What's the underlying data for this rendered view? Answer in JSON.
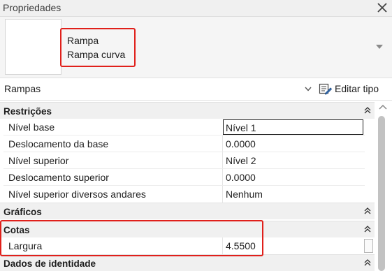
{
  "panel": {
    "title": "Propriedades"
  },
  "type_selector": {
    "family": "Rampa",
    "type": "Rampa curva"
  },
  "filter": {
    "selected": "Rampas",
    "edit_type_label": "Editar tipo"
  },
  "groups": {
    "restricoes": {
      "name": "Restrições",
      "rows": [
        {
          "label": "Nível base",
          "value": "Nível 1"
        },
        {
          "label": "Deslocamento da base",
          "value": "0.0000"
        },
        {
          "label": "Nível superior",
          "value": "Nível 2"
        },
        {
          "label": "Deslocamento superior",
          "value": "0.0000"
        },
        {
          "label": "Nível superior diversos andares",
          "value": "Nenhum"
        }
      ]
    },
    "graficos": {
      "name": "Gráficos"
    },
    "cotas": {
      "name": "Cotas",
      "rows": [
        {
          "label": "Largura",
          "value": "4.5500"
        }
      ]
    },
    "dados": {
      "name": "Dados de identidade"
    }
  },
  "colors": {
    "highlight": "#e0201b",
    "group_bg": "#f0f0f0",
    "scroll_thumb": "#c2c2c2"
  },
  "icons": {
    "close": "close-icon",
    "type_dropdown": "chevron-down-icon",
    "edit_type": "edit-type-icon",
    "collapse": "collapse-up-icon",
    "scroll_up": "chevron-up-icon"
  }
}
